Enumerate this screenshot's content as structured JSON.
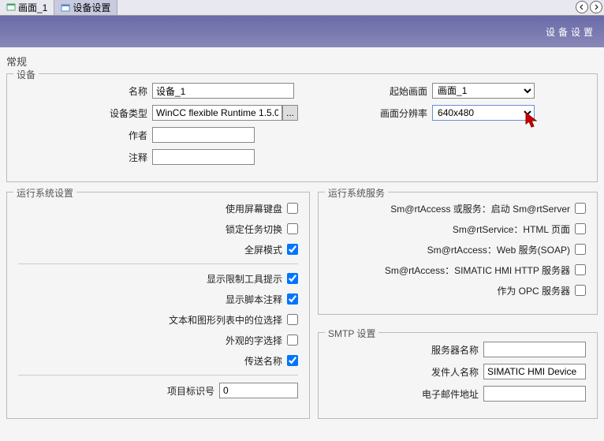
{
  "tabs": {
    "screen1": "画面_1",
    "device_settings": "设备设置"
  },
  "title": "设备设置",
  "general_label": "常规",
  "device": {
    "group_label": "设备",
    "name_label": "名称",
    "name_value": "设备_1",
    "type_label": "设备类型",
    "type_value": "WinCC flexible Runtime 1.5.0.( ...",
    "author_label": "作者",
    "author_value": "",
    "comment_label": "注释",
    "comment_value": "",
    "start_label": "起始画面",
    "start_value": "画面_1",
    "res_label": "画面分辨率",
    "res_value": "640x480"
  },
  "rt_settings": {
    "group_label": "运行系统设置",
    "use_keyboard": "使用屏幕键盘",
    "use_keyboard_checked": false,
    "lock_task": "锁定任务切换",
    "lock_task_checked": false,
    "fullscreen": "全屏模式",
    "fullscreen_checked": true,
    "show_limit": "显示限制工具提示",
    "show_limit_checked": true,
    "show_script": "显示脚本注释",
    "show_script_checked": true,
    "text_pos": "文本和图形列表中的位选择",
    "text_pos_checked": false,
    "font_sel": "外观的字选择",
    "font_sel_checked": false,
    "trans_name": "传送名称",
    "trans_name_checked": true,
    "proj_id_label": "项目标识号",
    "proj_id_value": "0"
  },
  "rt_services": {
    "group_label": "运行系统服务",
    "smart_access": "Sm@rtAccess 或服务：启动 Sm@rtServer",
    "smart_html": "Sm@rtService：HTML 页面",
    "smart_web": "Sm@rtAccess：Web 服务(SOAP)",
    "smart_http": "Sm@rtAccess：SIMATIC HMI HTTP 服务器",
    "opc": "作为 OPC 服务器"
  },
  "smtp": {
    "group_label": "SMTP 设置",
    "server_label": "服务器名称",
    "server_value": "",
    "sender_label": "发件人名称",
    "sender_value": "SIMATIC HMI Device",
    "email_label": "电子邮件地址",
    "email_value": ""
  }
}
